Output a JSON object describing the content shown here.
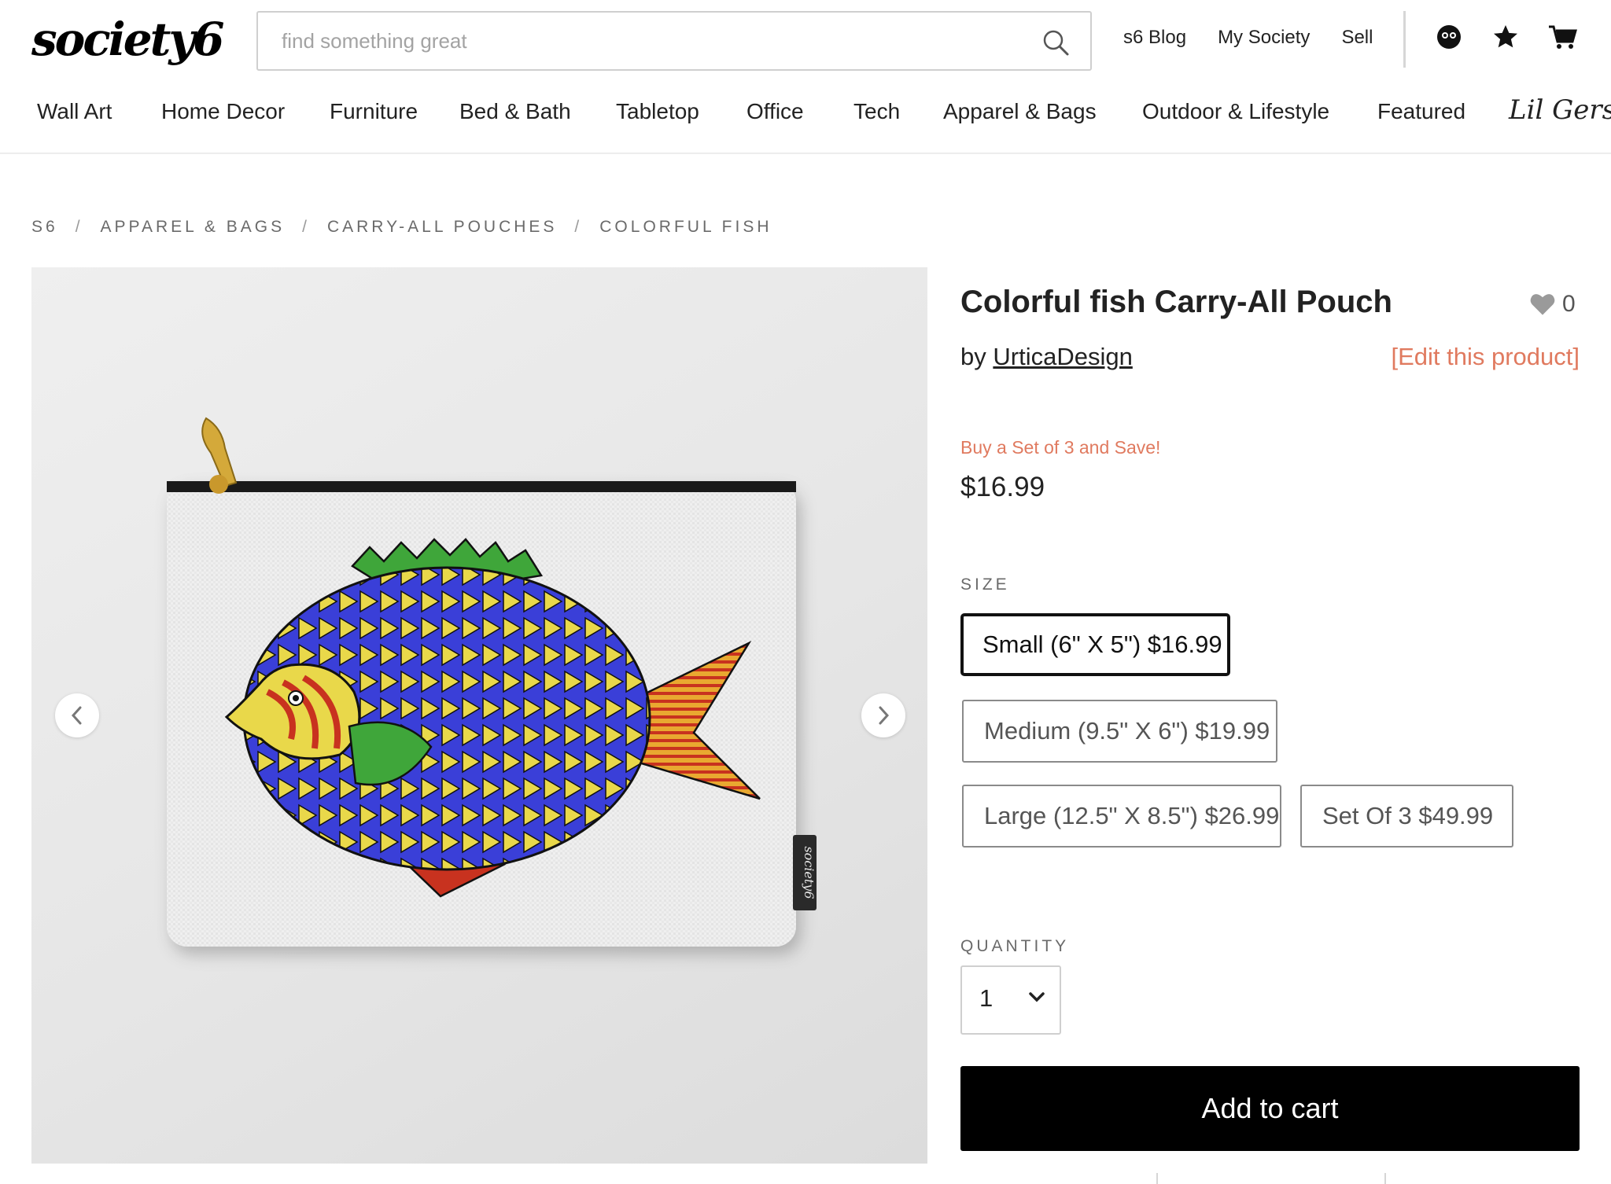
{
  "header": {
    "logo": "society6",
    "search_placeholder": "find something great",
    "links": [
      "s6 Blog",
      "My Society",
      "Sell"
    ],
    "icons": [
      "account-icon",
      "star-icon",
      "cart-icon"
    ]
  },
  "nav": {
    "items": [
      "Wall Art",
      "Home Decor",
      "Furniture",
      "Bed & Bath",
      "Tabletop",
      "Office",
      "Tech",
      "Apparel & Bags",
      "Outdoor & Lifestyle",
      "Featured"
    ],
    "special": "Lil Gers"
  },
  "breadcrumb": [
    "S6",
    "APPAREL & BAGS",
    "CARRY-ALL POUCHES",
    "COLORFUL FISH"
  ],
  "product": {
    "title": "Colorful fish Carry-All Pouch",
    "by_prefix": "by",
    "artist": "UrticaDesign",
    "edit_link": "[Edit this product]",
    "favorites": "0",
    "promo": "Buy a Set of 3 and Save!",
    "price": "$16.99",
    "image_brand_label": "society6",
    "size_label": "SIZE",
    "sizes": [
      {
        "label": "Small (6\" X 5\") $16.99",
        "selected": true
      },
      {
        "label": "Medium (9.5\" X 6\") $19.99",
        "selected": false
      },
      {
        "label": "Large (12.5\" X 8.5\") $26.99",
        "selected": false
      },
      {
        "label": "Set Of 3 $49.99",
        "selected": false
      }
    ],
    "quantity_label": "QUANTITY",
    "quantity": "1",
    "add_to_cart": "Add to cart"
  },
  "colors": {
    "accent": "#e07a5f",
    "primary_button": "#000000",
    "fish_body": "#3a3fd8",
    "fish_stripes": "#e9d84a",
    "fish_fin_green": "#3fa63a",
    "fish_tail": "#c8321f"
  }
}
